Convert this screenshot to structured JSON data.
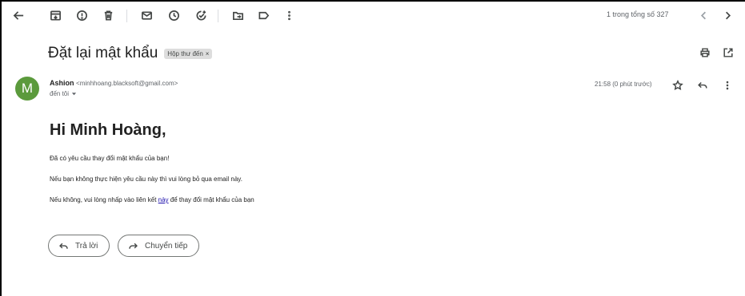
{
  "toolbar": {
    "back_icon": "arrow-left-icon",
    "archive_icon": "archive-icon",
    "spam_icon": "report-spam-icon",
    "delete_icon": "trash-icon",
    "unread_icon": "mark-unread-icon",
    "snooze_icon": "snooze-clock-icon",
    "task_icon": "add-task-icon",
    "move_icon": "move-to-folder-icon",
    "label_icon": "label-icon",
    "more_icon": "more-vertical-icon",
    "pager_text": "1 trong tổng số 327",
    "prev_icon": "chevron-left-icon",
    "next_icon": "chevron-right-icon"
  },
  "email": {
    "subject": "Đặt lại mật khẩu",
    "label_chip": "Hộp thư đến",
    "label_close": "×",
    "print_icon": "print-icon",
    "open_new_icon": "open-in-new-window-icon",
    "avatar_letter": "M",
    "avatar_color": "#5b9a3c",
    "sender_name": "Ashion",
    "sender_email": "<minhhoang.blacksoft@gmail.com>",
    "to_text": "đến tôi",
    "timestamp": "21:58 (0 phút trước)",
    "star_icon": "star-icon",
    "reply_icon": "reply-icon",
    "more_icon": "more-vertical-icon"
  },
  "body": {
    "greeting": "Hi Minh Hoàng,",
    "line1": "Đã có yêu cầu thay đổi mật khẩu của bạn!",
    "line2": "Nếu bạn không thực hiện yêu cầu này thì vui lòng bỏ qua email này.",
    "line3_before": "Nếu không, vui lòng nhấp vào liên kết ",
    "line3_link": "này",
    "line3_after": " để thay đổi mật khẩu của bạn"
  },
  "actions": {
    "reply_label": "Trả lời",
    "forward_label": "Chuyển tiếp",
    "link_color": "#1a0dab"
  }
}
